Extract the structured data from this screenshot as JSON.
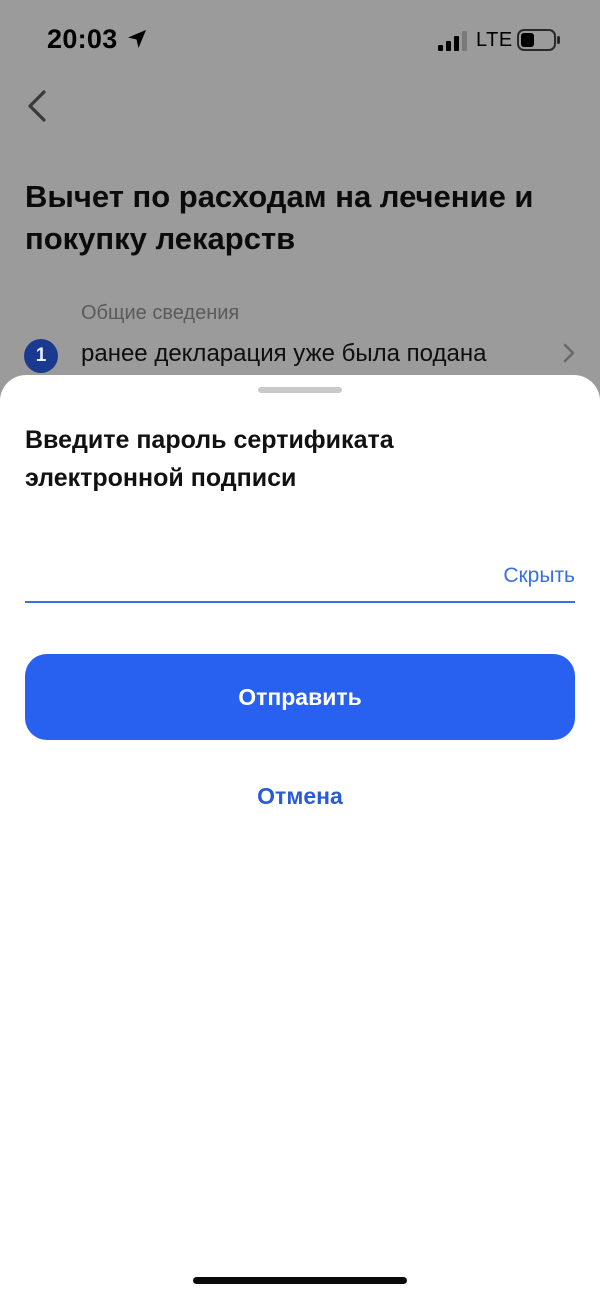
{
  "status_bar": {
    "time": "20:03",
    "network": "LTE"
  },
  "page": {
    "title": "Вычет по расходам на лечение и покупку лекарств",
    "step": {
      "caption": "Общие сведения",
      "number": "1",
      "text": "ранее декларация уже была подана"
    }
  },
  "sheet": {
    "title": "Введите пароль сертификата электронной подписи",
    "password": {
      "value": "",
      "toggle_label": "Скрыть"
    },
    "submit_label": "Отправить",
    "cancel_label": "Отмена"
  },
  "colors": {
    "accent": "#2860f0",
    "link": "#2a5bd7",
    "overlay": "#9b9b9b"
  }
}
